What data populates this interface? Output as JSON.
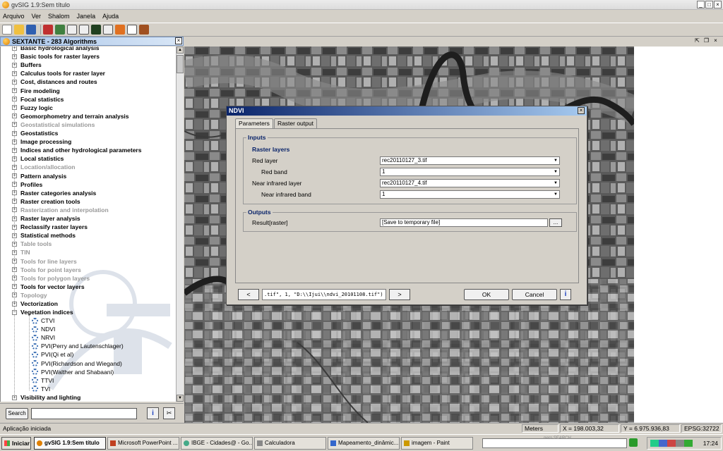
{
  "window": {
    "title": "gvSIG 1.9:Sem título",
    "controls": [
      "_",
      "□",
      "×"
    ]
  },
  "menu": [
    "Arquivo",
    "Ver",
    "Shalom",
    "Janela",
    "Ajuda"
  ],
  "sextante": {
    "title": "SEXTANTE - 283 Algorithms",
    "groups": [
      {
        "label": "Basic hydrological analysis",
        "enabled": true
      },
      {
        "label": "Basic tools for raster layers",
        "enabled": true
      },
      {
        "label": "Buffers",
        "enabled": true
      },
      {
        "label": "Calculus tools for raster layer",
        "enabled": true
      },
      {
        "label": "Cost, distances and routes",
        "enabled": true
      },
      {
        "label": "Fire modeling",
        "enabled": true
      },
      {
        "label": "Focal statistics",
        "enabled": true
      },
      {
        "label": "Fuzzy logic",
        "enabled": true
      },
      {
        "label": "Geomorphometry and terrain analysis",
        "enabled": true
      },
      {
        "label": "Geostatistical simulations",
        "enabled": false
      },
      {
        "label": "Geostatistics",
        "enabled": true
      },
      {
        "label": "Image processing",
        "enabled": true
      },
      {
        "label": "Indices and other hydrological parameters",
        "enabled": true
      },
      {
        "label": "Local statistics",
        "enabled": true
      },
      {
        "label": "Location/allocation",
        "enabled": false
      },
      {
        "label": "Pattern analysis",
        "enabled": true
      },
      {
        "label": "Profiles",
        "enabled": true
      },
      {
        "label": "Raster categories analysis",
        "enabled": true
      },
      {
        "label": "Raster creation tools",
        "enabled": true
      },
      {
        "label": "Rasterization and interpolation",
        "enabled": false
      },
      {
        "label": "Raster layer analysis",
        "enabled": true
      },
      {
        "label": "Reclassify raster layers",
        "enabled": true
      },
      {
        "label": "Statistical methods",
        "enabled": true
      },
      {
        "label": "Table tools",
        "enabled": false
      },
      {
        "label": "TIN",
        "enabled": false
      },
      {
        "label": "Tools for line layers",
        "enabled": false
      },
      {
        "label": "Tools for point layers",
        "enabled": false
      },
      {
        "label": "Tools for polygon layers",
        "enabled": false
      },
      {
        "label": "Tools for vector layers",
        "enabled": true
      },
      {
        "label": "Topology",
        "enabled": false
      },
      {
        "label": "Vectorization",
        "enabled": true
      },
      {
        "label": "Vegetation indices",
        "enabled": true,
        "expanded": true
      }
    ],
    "vegetation_children": [
      "CTVI",
      "NDVI",
      "NRVI",
      "PVI(Perry and Lautenschlager)",
      "PVI(Qi et al)",
      "PVI(Richardson and Wiegand)",
      "PVI(Walther and Shabaani)",
      "TTVI",
      "TVI"
    ],
    "last_group": "Visibility and lighting",
    "search_label": "Search",
    "search_value": ""
  },
  "dialog": {
    "title": "NDVI",
    "tabs": [
      "Parameters",
      "Raster output"
    ],
    "inputs_title": "Inputs",
    "raster_layers_title": "Raster layers",
    "red_layer_label": "Red layer",
    "red_layer_value": "rec20110127_3.tif",
    "red_band_label": "Red band",
    "red_band_value": "1",
    "nir_layer_label": "Near infrared layer",
    "nir_layer_value": "rec20110127_4.tif",
    "nir_band_label": "Near infrared band",
    "nir_band_value": "1",
    "outputs_title": "Outputs",
    "result_label": "Result[raster]",
    "result_value": "[Save to temporary file]",
    "browse_label": "...",
    "prev_label": "<",
    "next_label": ">",
    "command": ".tif\", 1, \"D:\\\\Ijui\\\\ndvi_20101108.tif\")",
    "ok_label": "OK",
    "cancel_label": "Cancel",
    "help_label": "i"
  },
  "status": {
    "message": "Aplicação iniciada",
    "units": "Meters",
    "x": "X = 198.003,32",
    "y": "Y = 6.975.936,83",
    "epsg": "EPSG:32722"
  },
  "taskbar": {
    "start": "Iniciar",
    "tasks": [
      "gvSIG 1.9:Sem título",
      "Microsoft PowerPoint ...",
      "IBGE - Cidades@ - Go...",
      "Calculadora",
      "Mapeamento_dinâmic...",
      "imagem - Paint"
    ],
    "nero": "nero SEARCH",
    "time": "17:24"
  }
}
